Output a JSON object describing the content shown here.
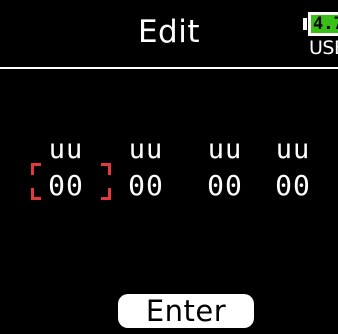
{
  "header": {
    "title": "Edit",
    "battery": {
      "level_text": "4.7",
      "source": "USB",
      "level_color": "#38c018"
    }
  },
  "editor": {
    "selected_index": 0,
    "selection_color": "#e23a3a",
    "fields": [
      {
        "unit": "uu",
        "value": "00"
      },
      {
        "unit": "uu",
        "value": "00"
      },
      {
        "unit": "uu",
        "value": "00"
      },
      {
        "unit": "uu",
        "value": "00"
      }
    ]
  },
  "footer": {
    "enter_label": "Enter"
  }
}
